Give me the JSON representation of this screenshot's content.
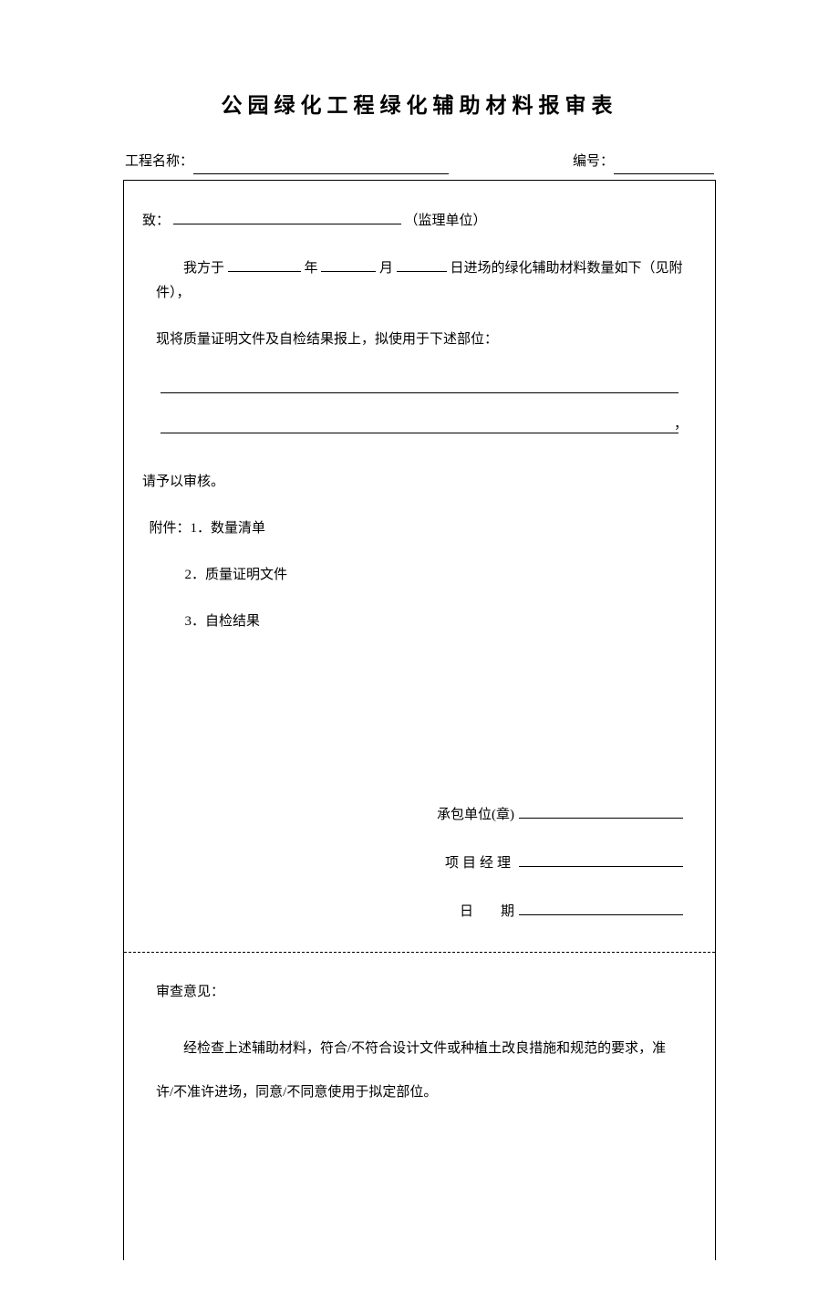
{
  "title": "公园绿化工程绿化辅助材料报审表",
  "meta": {
    "project_label": "工程名称：",
    "number_label": "编号："
  },
  "top": {
    "to_label": "致：",
    "to_suffix": "（监理单位）",
    "body_prefix": "我方于",
    "year_label": "年",
    "month_label": "月",
    "day_suffix": "日进场的绿化辅助材料数量如下（见附件），",
    "body_line2": "现将质量证明文件及自检结果报上，拟使用于下述部位：",
    "request": "请予以审核。",
    "attach_label": "附件：1．数量清单",
    "attach2": "2．质量证明文件",
    "attach3": "3．自检结果",
    "sign_unit": "承包单位(章)",
    "sign_manager": "项目经理",
    "sign_date_label": "日",
    "sign_date_label2": "期"
  },
  "bottom": {
    "review_label": "审查意见：",
    "review_body": "经检查上述辅助材料，符合/不符合设计文件或种植土改良措施和规范的要求，准许/不准许进场，同意/不同意使用于拟定部位。"
  }
}
